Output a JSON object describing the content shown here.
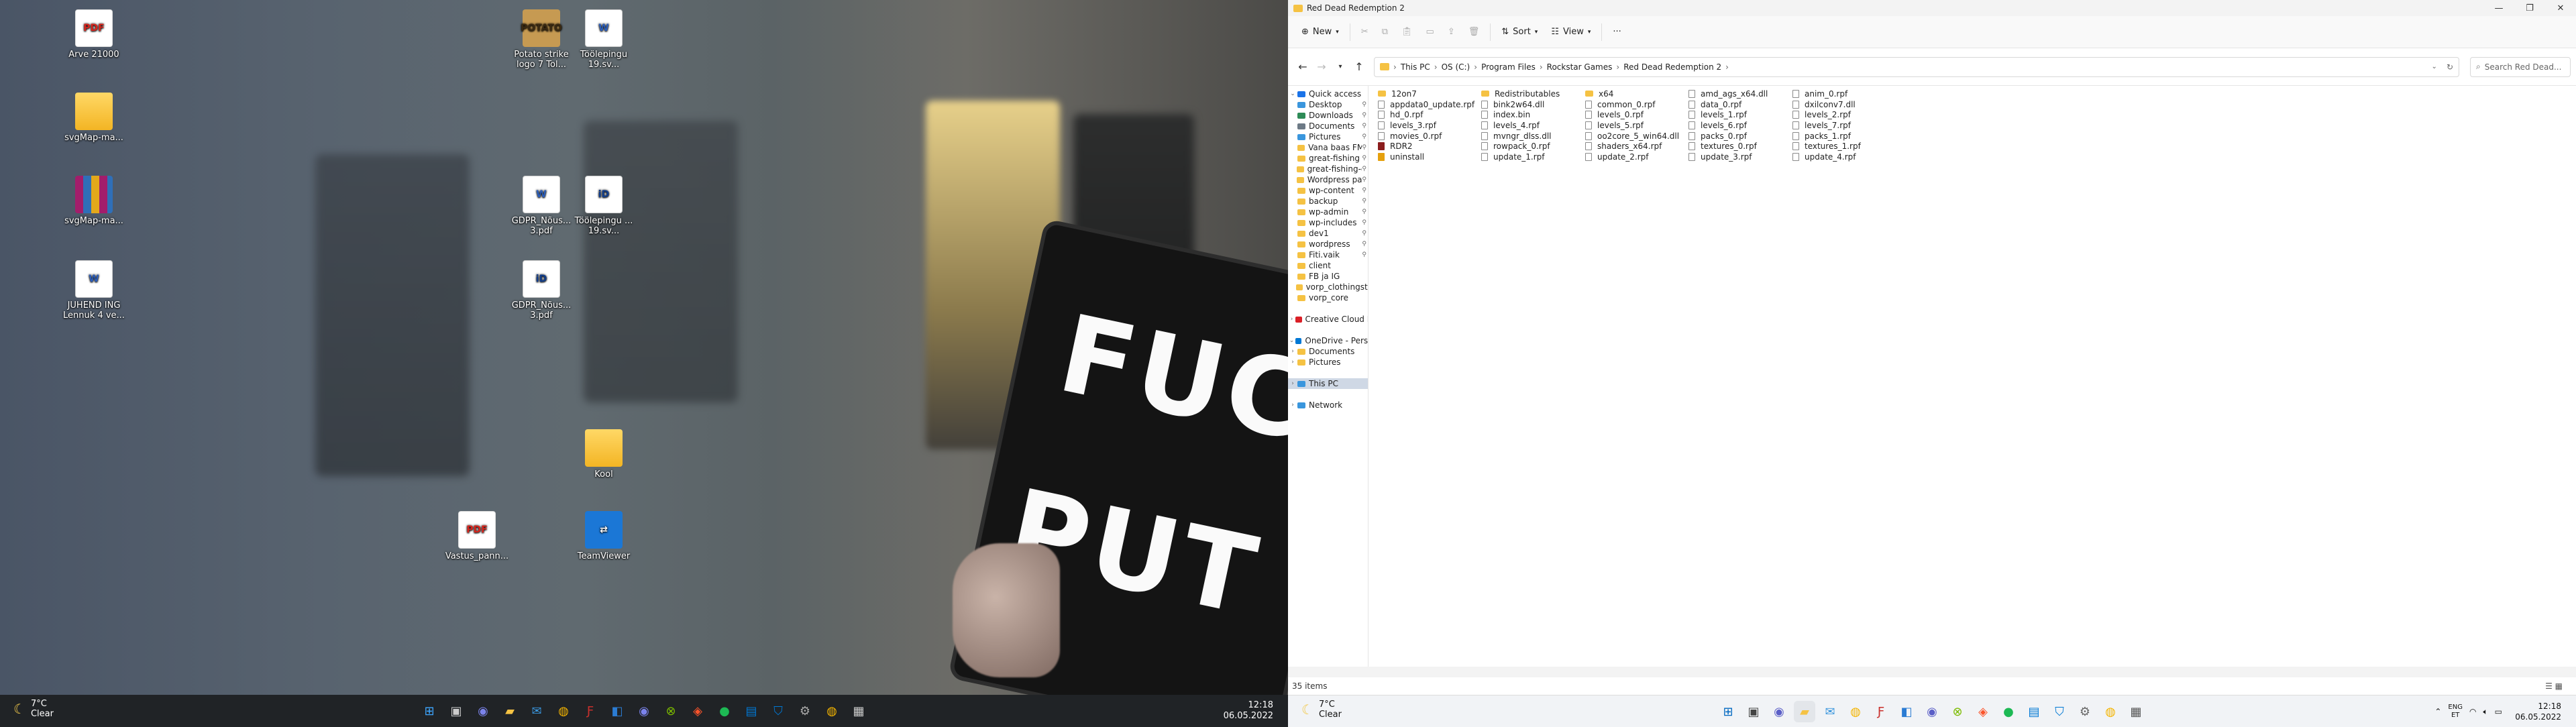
{
  "desktop": {
    "icons": [
      {
        "name": "pdf-icon",
        "label": "Arve 21000",
        "type": "pdf"
      },
      {
        "name": "folder-icon",
        "label": "svgMap-ma...",
        "type": "folder"
      },
      {
        "name": "rar-icon",
        "label": "svgMap-ma...",
        "type": "rar"
      },
      {
        "name": "word-icon",
        "label": "JUHEND ING Lennuk 4 ve...",
        "type": "word"
      },
      {
        "name": "logo-icon",
        "label": "Potato strike logo 7 Tol...",
        "type": "logo"
      },
      {
        "name": "word-icon",
        "label": "Töölepingu 19.sv...",
        "type": "word"
      },
      {
        "name": "word-icon",
        "label": "GDPR_Nõus... 3.pdf",
        "type": "word"
      },
      {
        "name": "idoc-icon",
        "label": "Töölepingu ... 19.sv...",
        "type": "idoc"
      },
      {
        "name": "idoc-icon",
        "label": "GDPR_Nõus... 3.pdf",
        "type": "idoc"
      },
      {
        "name": "folder-icon",
        "label": "Kool",
        "type": "folder"
      },
      {
        "name": "pdf-icon",
        "label": "Vastus_pann...",
        "type": "pdf"
      },
      {
        "name": "teamviewer-icon",
        "label": "TeamViewer",
        "type": "tv"
      }
    ],
    "sign_line1": "FUC",
    "sign_line2": "PUT"
  },
  "taskbar_left": {
    "weather_temp": "7°C",
    "weather_desc": "Clear",
    "time": "12:18",
    "date": "06.05.2022",
    "apps": [
      "start-icon",
      "task-view-icon",
      "teams-icon",
      "file-explorer-icon",
      "mail-icon",
      "chrome-icon",
      "filezilla-icon",
      "outlook-icon",
      "teams-chat-icon",
      "xbox-icon",
      "brave-icon",
      "spotify-icon",
      "photos-icon",
      "defender-icon",
      "settings-icon",
      "chrome-alt-icon",
      "calculator-icon"
    ]
  },
  "explorer": {
    "title": "Red Dead Redemption 2",
    "cmd": {
      "new": "New",
      "sort": "Sort",
      "view": "View",
      "more": "···"
    },
    "breadcrumb": [
      "This PC",
      "OS (C:)",
      "Program Files",
      "Rockstar Games",
      "Red Dead Redemption 2"
    ],
    "search_placeholder": "Search Red Dead...",
    "nav": [
      {
        "label": "Quick access",
        "icon": "star",
        "chev": "v",
        "pin": false
      },
      {
        "label": "Desktop",
        "icon": "desktop",
        "pin": true
      },
      {
        "label": "Downloads",
        "icon": "download",
        "pin": true
      },
      {
        "label": "Documents",
        "icon": "doc",
        "pin": true
      },
      {
        "label": "Pictures",
        "icon": "pic",
        "pin": true
      },
      {
        "label": "Vana baas FM",
        "icon": "folder",
        "pin": true
      },
      {
        "label": "great-fishing",
        "icon": "folder",
        "pin": true
      },
      {
        "label": "great-fishing-cl",
        "icon": "folder",
        "pin": true
      },
      {
        "label": "Wordpress pah",
        "icon": "folder",
        "pin": true
      },
      {
        "label": "wp-content",
        "icon": "folder",
        "pin": true
      },
      {
        "label": "backup",
        "icon": "folder",
        "pin": true
      },
      {
        "label": "wp-admin",
        "icon": "folder",
        "pin": true
      },
      {
        "label": "wp-includes",
        "icon": "folder",
        "pin": true
      },
      {
        "label": "dev1",
        "icon": "folder",
        "pin": true
      },
      {
        "label": "wordpress",
        "icon": "folder",
        "pin": true
      },
      {
        "label": "Fiti.vaik",
        "icon": "folder",
        "pin": true
      },
      {
        "label": "client",
        "icon": "folder",
        "pin": false
      },
      {
        "label": "FB ja IG",
        "icon": "folder",
        "pin": false
      },
      {
        "label": "vorp_clothingstore",
        "icon": "folder",
        "pin": false
      },
      {
        "label": "vorp_core",
        "icon": "folder",
        "pin": false
      },
      {
        "label": "",
        "icon": "",
        "pin": false
      },
      {
        "label": "Creative Cloud Files",
        "icon": "cc",
        "chev": ">",
        "pin": false
      },
      {
        "label": "",
        "icon": "",
        "pin": false
      },
      {
        "label": "OneDrive - Personal",
        "icon": "cloud",
        "chev": "v",
        "pin": false
      },
      {
        "label": "Documents",
        "icon": "folder",
        "chev": ">",
        "pin": false
      },
      {
        "label": "Pictures",
        "icon": "folder",
        "chev": ">",
        "pin": false
      },
      {
        "label": "",
        "icon": "",
        "pin": false
      },
      {
        "label": "This PC",
        "icon": "pc",
        "chev": ">",
        "pin": false,
        "sel": true
      },
      {
        "label": "",
        "icon": "",
        "pin": false
      },
      {
        "label": "Network",
        "icon": "net",
        "chev": ">",
        "pin": false
      }
    ],
    "files": [
      [
        {
          "name": "12on7",
          "type": "folder"
        },
        {
          "name": "appdata0_update.rpf",
          "type": "file"
        },
        {
          "name": "hd_0.rpf",
          "type": "file"
        },
        {
          "name": "levels_3.rpf",
          "type": "file"
        },
        {
          "name": "movies_0.rpf",
          "type": "file"
        },
        {
          "name": "RDR2",
          "type": "exe"
        },
        {
          "name": "uninstall",
          "type": "uni"
        }
      ],
      [
        {
          "name": "Redistributables",
          "type": "folder"
        },
        {
          "name": "bink2w64.dll",
          "type": "file"
        },
        {
          "name": "index.bin",
          "type": "file"
        },
        {
          "name": "levels_4.rpf",
          "type": "file"
        },
        {
          "name": "mvngr_dlss.dll",
          "type": "file"
        },
        {
          "name": "rowpack_0.rpf",
          "type": "file"
        },
        {
          "name": "update_1.rpf",
          "type": "file"
        }
      ],
      [
        {
          "name": "x64",
          "type": "folder"
        },
        {
          "name": "common_0.rpf",
          "type": "file"
        },
        {
          "name": "levels_0.rpf",
          "type": "file"
        },
        {
          "name": "levels_5.rpf",
          "type": "file"
        },
        {
          "name": "oo2core_5_win64.dll",
          "type": "file"
        },
        {
          "name": "shaders_x64.rpf",
          "type": "file"
        },
        {
          "name": "update_2.rpf",
          "type": "file"
        }
      ],
      [
        {
          "name": "amd_ags_x64.dll",
          "type": "file"
        },
        {
          "name": "data_0.rpf",
          "type": "file"
        },
        {
          "name": "levels_1.rpf",
          "type": "file"
        },
        {
          "name": "levels_6.rpf",
          "type": "file"
        },
        {
          "name": "packs_0.rpf",
          "type": "file"
        },
        {
          "name": "textures_0.rpf",
          "type": "file"
        },
        {
          "name": "update_3.rpf",
          "type": "file"
        }
      ],
      [
        {
          "name": "anim_0.rpf",
          "type": "file"
        },
        {
          "name": "dxilconv7.dll",
          "type": "file"
        },
        {
          "name": "levels_2.rpf",
          "type": "file"
        },
        {
          "name": "levels_7.rpf",
          "type": "file"
        },
        {
          "name": "packs_1.rpf",
          "type": "file"
        },
        {
          "name": "textures_1.rpf",
          "type": "file"
        },
        {
          "name": "update_4.rpf",
          "type": "file"
        }
      ]
    ],
    "status_items": "35 items"
  },
  "taskbar_right": {
    "weather_temp": "7°C",
    "weather_desc": "Clear",
    "lang_top": "ENG",
    "lang_bottom": "ET",
    "time": "12:18",
    "date": "06.05.2022"
  }
}
